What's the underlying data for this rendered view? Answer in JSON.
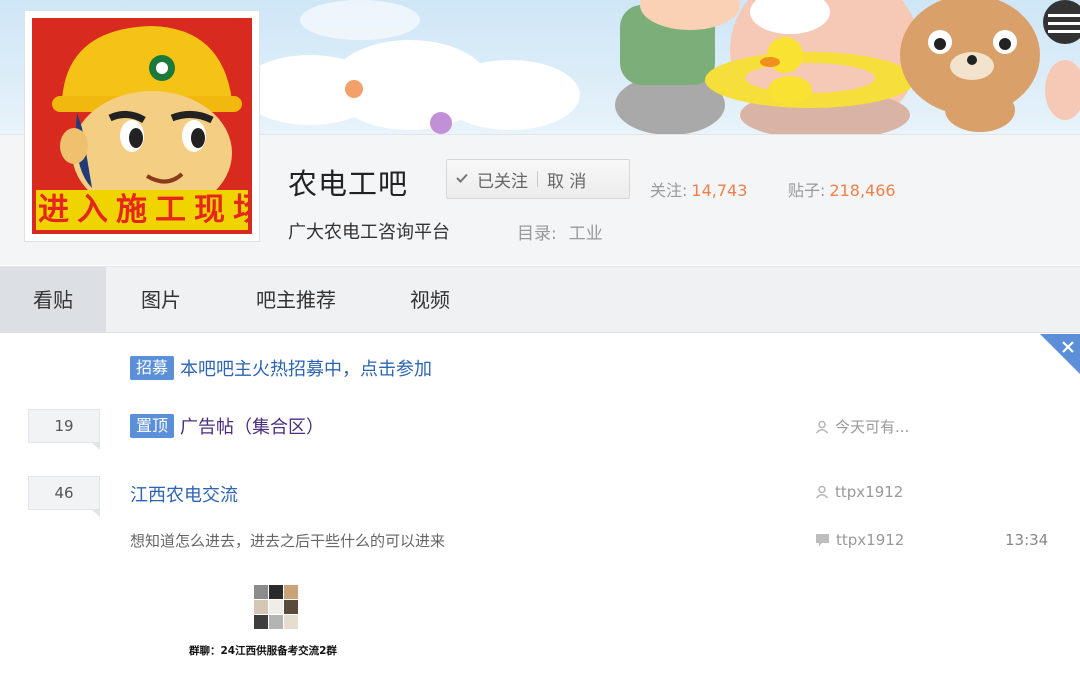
{
  "logo": {
    "text": "进入施工现场"
  },
  "forum": {
    "name": "农电工吧",
    "follow_label": "已关注",
    "cancel_label": "取 消",
    "follow_stat_label": "关注:",
    "follow_stat_value": "14,743",
    "posts_stat_label": "贴子:",
    "posts_stat_value": "218,466",
    "slogan": "广大农电工咨询平台",
    "catalog_label": "目录:",
    "catalog_value": "工业"
  },
  "tabs": [
    "看贴",
    "图片",
    "吧主推荐",
    "视频"
  ],
  "active_tab": "看贴",
  "threads": [
    {
      "tag": "招募",
      "title": "本吧吧主火热招募中，点击参加"
    },
    {
      "reply_count": "19",
      "tag": "置顶",
      "title": "广告帖（集合区）",
      "author": "今天可有..."
    },
    {
      "reply_count": "46",
      "title": "江西农电交流",
      "author": "ttpx1912",
      "excerpt": "想知道怎么进去，进去之后干些什么的可以进来",
      "last_replier": "ttpx1912",
      "time": "13:34",
      "image_caption": "群聊：24江西供服备考交流2群"
    }
  ],
  "colors": {
    "tag_blue": "#5b8fd7",
    "link_blue": "#2d64b3",
    "link_purple": "#4b2d7f",
    "stat_orange": "#f0804a",
    "logo_red": "#d82a1e",
    "logo_yellow": "#f0d400"
  },
  "icons": [
    "check-icon",
    "user-icon",
    "comment-icon",
    "close-icon"
  ]
}
